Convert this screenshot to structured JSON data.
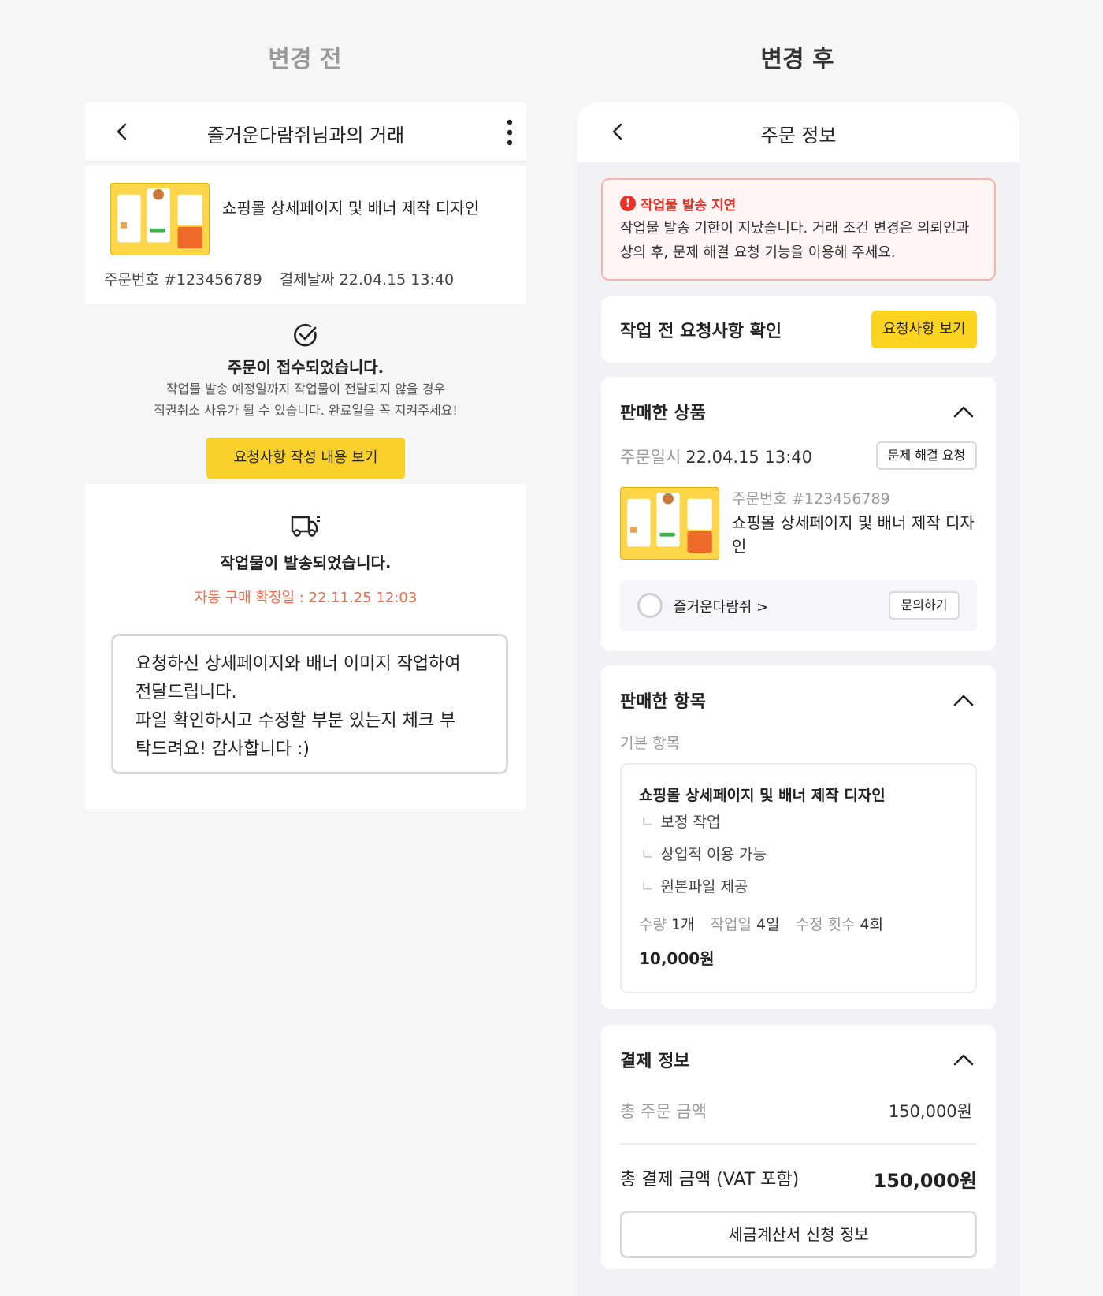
{
  "titles": {
    "before": "변경 전",
    "after": "변경 후"
  },
  "before": {
    "header_title": "즐거운다람쥐님과의 거래",
    "product_name": "쇼핑몰 상세페이지 및 배너 제작 디자인",
    "order_no": "주문번호 #123456789",
    "pay_date": "결제날짜 22.04.15 13:40",
    "status1_title": "주문이 접수되었습니다.",
    "status1_desc_line1": "작업물 발송 예정일까지 작업물이 전달되지 않을 경우",
    "status1_desc_line2": "직권취소 사유가 될 수 있습니다. 완료일을 꼭 지켜주세요!",
    "request_button": "요청사항 작성 내용 보기",
    "ship_title": "작업물이 발송되었습니다.",
    "auto_confirm": "자동 구매 확정일 : 22.11.25 12:03",
    "message": "요청하신 상세페이지와 배너 이미지 작업하여\n전달드립니다.\n파일 확인하시고 수정할 부분 있는지 체크 부\n탁드려요! 감사합니다 :)"
  },
  "after": {
    "header_title": "주문 정보",
    "alert_title": "작업물 발송 지연",
    "alert_text": "작업물 발송 기한이 지났습니다. 거래 조건 변경은 의뢰인과 상의 후, 문제 해결 요청 기능을 이용해 주세요.",
    "request_card_title": "작업 전 요청사항 확인",
    "request_button": "요청사항 보기",
    "sold_product_title": "판매한 상품",
    "order_date_label": "주문일시",
    "order_date_value": "22.04.15 13:40",
    "issue_button": "문제 해결 요청",
    "product_no": "주문번호 #123456789",
    "product_name": "쇼핑몰 상세페이지 및 배너 제작 디자인",
    "seller_name": "즐거운다람쥐 >",
    "inquiry_button": "문의하기",
    "sold_items_title": "판매한 항목",
    "basic_label": "기본 항목",
    "item_name": "쇼핑몰 상세페이지 및 배너 제작 디자인",
    "options": [
      "보정 작업",
      "상업적 이용 가능",
      "원본파일 제공"
    ],
    "option_mark": "ㄴ",
    "qty_label": "수량",
    "qty_value": "1개",
    "days_label": "작업일",
    "days_value": "4일",
    "revisions_label": "수정 횟수",
    "revisions_value": "4회",
    "item_price": "10,000원",
    "payment_title": "결제 정보",
    "total_order_label": "총 주문 금액",
    "total_order_value": "150,000원",
    "total_pay_label": "총 결제 금액 (VAT 포함)",
    "total_pay_value": "150,000원",
    "tax_button": "세금계산서 신청 정보"
  },
  "colors": {
    "accent_yellow": "#f9d12a",
    "alert_red": "#e8322a",
    "auto_confirm": "#ef6a4a"
  }
}
